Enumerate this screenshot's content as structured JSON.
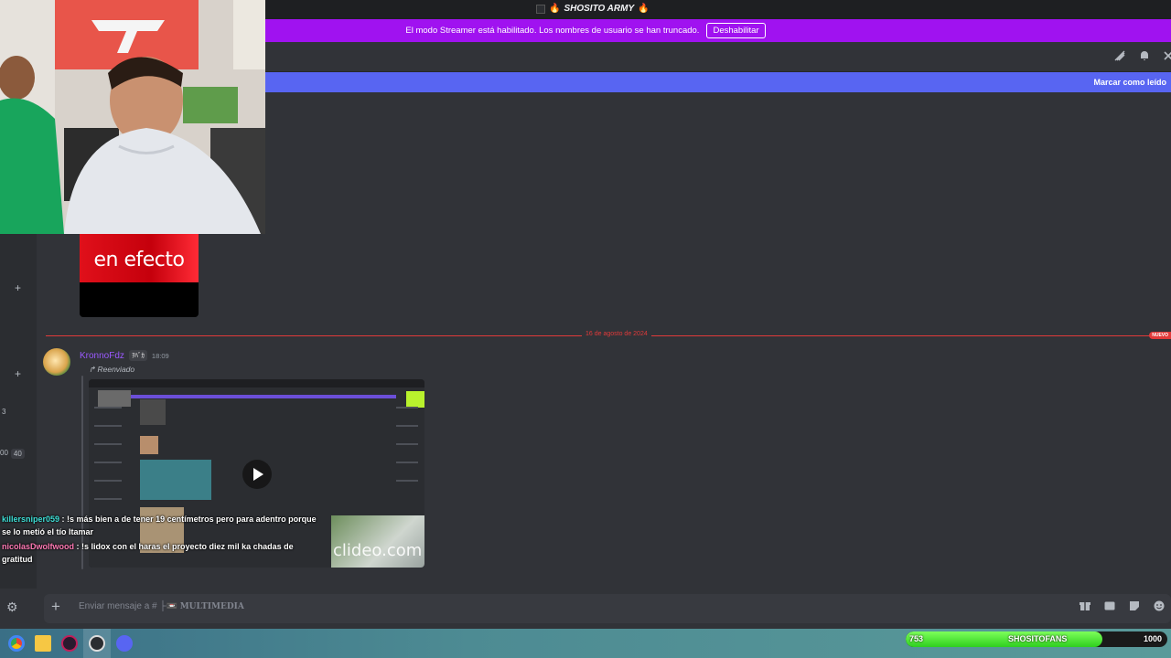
{
  "titlebar": {
    "server_name": "SHOSITO ARMY",
    "flame_left": "🔥",
    "flame_right": "🔥"
  },
  "banner": {
    "text": "El modo Streamer está habilitado. Los nombres de usuario se han truncado.",
    "button": "Deshabilitar"
  },
  "header": {
    "icons": [
      "threads-icon",
      "bell-icon",
      "pin-icon"
    ]
  },
  "new_messages": {
    "mark_read": "Marcar como leído"
  },
  "image": {
    "caption": "en efecto"
  },
  "divider": {
    "date": "16 de agosto de 2024",
    "new_tag": "NUEVO"
  },
  "left_strip": {
    "count": "3",
    "num_a": "00",
    "num_b": "40"
  },
  "message": {
    "username": "KronnoFdz",
    "tag": "ｦﾊﾞｶ",
    "time": "18:09",
    "forwarded": "Reenviado",
    "video_watermark": "clideo.com"
  },
  "chat": [
    {
      "user": "killersniper059",
      "text": " : !s más bien a de tener 19 centímetros pero para adentro porque se lo metió el tío Itamar"
    },
    {
      "user": "nicolasDwolfwood",
      "text": " : !s lidox con el haras el proyecto diez mil ka chadas de gratitud"
    }
  ],
  "composer": {
    "placeholder": "Enviar mensaje a # ├📼",
    "channel": "MULTIMEDIA"
  },
  "progress": {
    "current": "753",
    "label": "SHOSITOFANS",
    "goal": "1000",
    "fraction": 0.753
  },
  "colors": {
    "accent": "#5865f2",
    "banner": "#a012f0",
    "username": "#9b59ff",
    "divider": "#e13a3a"
  }
}
